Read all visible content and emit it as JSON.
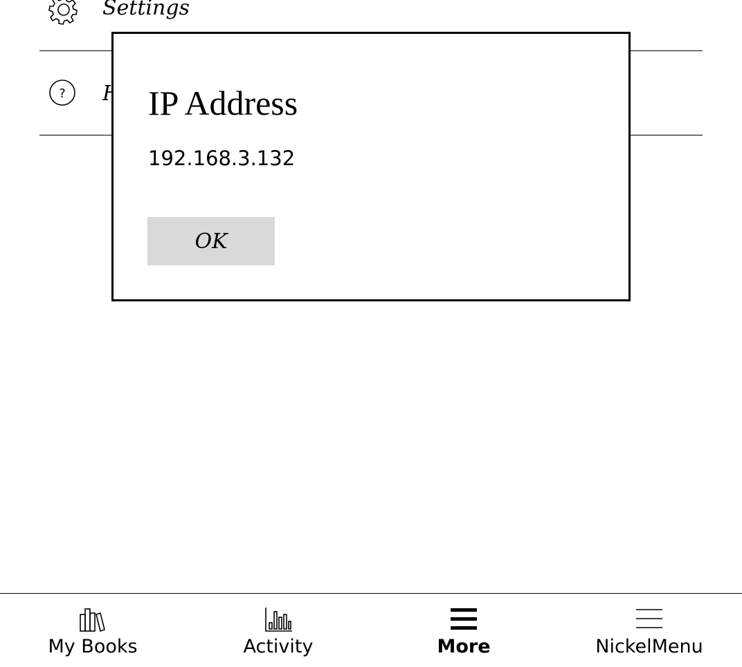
{
  "menu": {
    "items": [
      {
        "label": "Settings",
        "icon": "gear-icon"
      },
      {
        "label": "Help",
        "icon": "help-icon"
      }
    ]
  },
  "dialog": {
    "title": "IP Address",
    "message": "192.168.3.132",
    "ok_label": "OK"
  },
  "nav": {
    "items": [
      {
        "label": "My Books",
        "icon": "books-icon",
        "active": false
      },
      {
        "label": "Activity",
        "icon": "activity-chart-icon",
        "active": false
      },
      {
        "label": "More",
        "icon": "menu-bold-icon",
        "active": true
      },
      {
        "label": "NickelMenu",
        "icon": "menu-icon",
        "active": false
      }
    ]
  }
}
